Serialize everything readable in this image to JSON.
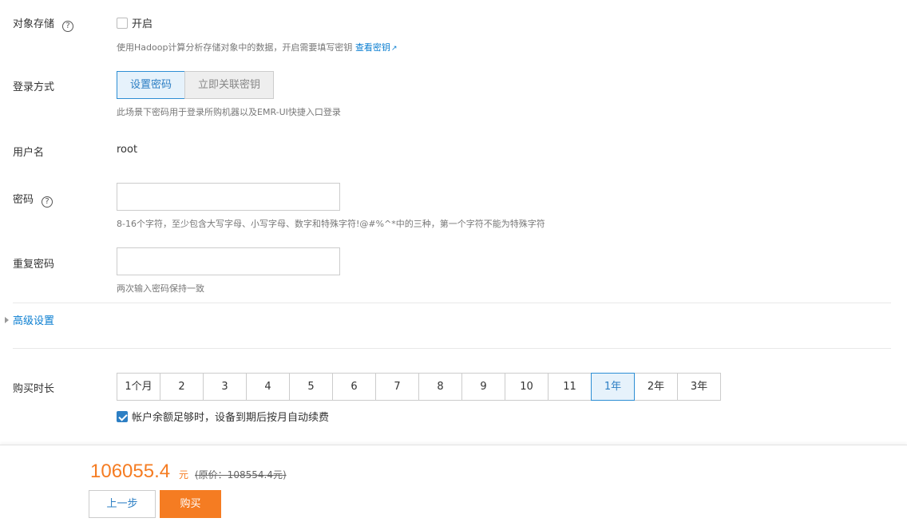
{
  "object_storage": {
    "label": "对象存储",
    "help": "?",
    "checkbox_label": "开启",
    "checked": false,
    "hint": "使用Hadoop计算分析存储对象中的数据，开启需要填写密钥",
    "hint_link": "查看密钥"
  },
  "login_method": {
    "label": "登录方式",
    "options": [
      "设置密码",
      "立即关联密钥"
    ],
    "selected": "设置密码",
    "hint": "此场景下密码用于登录所购机器以及EMR-UI快捷入口登录"
  },
  "username": {
    "label": "用户名",
    "value": "root"
  },
  "password": {
    "label": "密码",
    "help": "?",
    "value": "",
    "hint": "8-16个字符，至少包含大写字母、小写字母、数字和特殊字符!@#%^*中的三种，第一个字符不能为特殊字符"
  },
  "repeat_password": {
    "label": "重复密码",
    "value": "",
    "hint": "两次输入密码保持一致"
  },
  "advanced": {
    "label": "高级设置"
  },
  "duration": {
    "label": "购买时长",
    "options": [
      "1个月",
      "2",
      "3",
      "4",
      "5",
      "6",
      "7",
      "8",
      "9",
      "10",
      "11",
      "1年",
      "2年",
      "3年"
    ],
    "selected": "1年",
    "auto_renew_label": "帐户余额足够时，设备到期后按月自动续费",
    "auto_renew_checked": true
  },
  "footer": {
    "price": "106055.4",
    "unit": "元",
    "original_price": "(原价：108554.4元)",
    "prev_label": "上一步",
    "buy_label": "购买"
  },
  "colors": {
    "accent": "#2d7fc4",
    "price": "#f57c22",
    "link": "#0a7ed1"
  }
}
